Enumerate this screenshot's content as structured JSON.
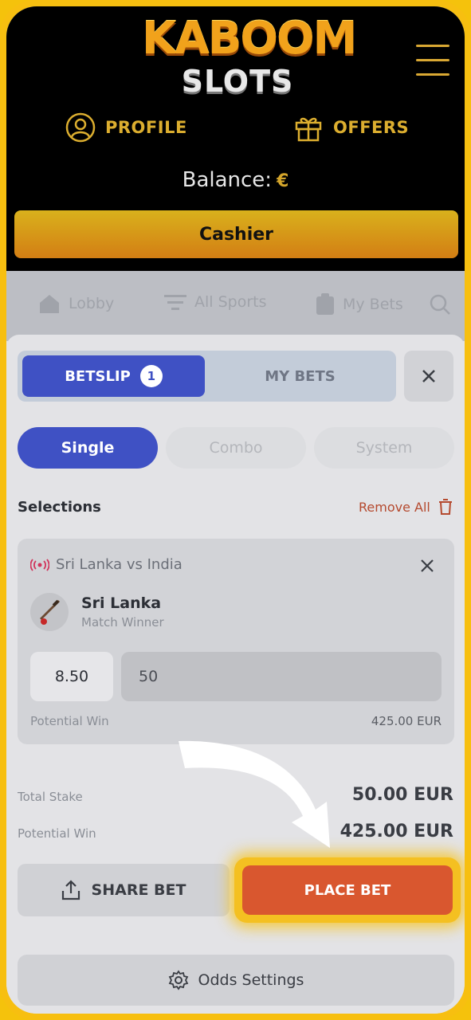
{
  "brand": {
    "logo_top": "KABOOM",
    "logo_bottom": "SLOTS"
  },
  "header": {
    "profile_label": "PROFILE",
    "offers_label": "OFFERS",
    "balance_label": "Balance:",
    "balance_currency": "€",
    "cashier_label": "Cashier"
  },
  "subnav": {
    "lobby": "Lobby",
    "all_sports": "All Sports",
    "my_bets": "My Bets"
  },
  "betslip": {
    "tab_betslip": "BETSLIP",
    "betslip_count": "1",
    "tab_mybets": "MY BETS",
    "modes": [
      "Single",
      "Combo",
      "System"
    ],
    "selections_title": "Selections",
    "remove_all": "Remove All",
    "selection": {
      "match": "Sri Lanka vs India",
      "team": "Sri Lanka",
      "market": "Match Winner",
      "odds": "8.50",
      "stake": "50",
      "potential_win_label": "Potential Win",
      "potential_win_value": "425.00 EUR"
    },
    "total_stake_label": "Total Stake",
    "total_stake_value": "50.00 EUR",
    "potential_win_label": "Potential Win",
    "potential_win_value": "425.00 EUR",
    "share_label": "SHARE BET",
    "place_label": "PLACE BET",
    "odds_settings_label": "Odds Settings"
  },
  "colors": {
    "accent": "#3f51c4",
    "place_bet": "#d9572f",
    "highlight": "#f4c021",
    "gold": "#dcae2f"
  },
  "icons": [
    "profile-icon",
    "gift-icon",
    "hamburger-icon",
    "home-icon",
    "filter-icon",
    "clipboard-icon",
    "search-icon",
    "close-icon",
    "trash-icon",
    "live-icon",
    "cricket-icon",
    "share-icon",
    "gear-icon",
    "arrow-icon"
  ]
}
